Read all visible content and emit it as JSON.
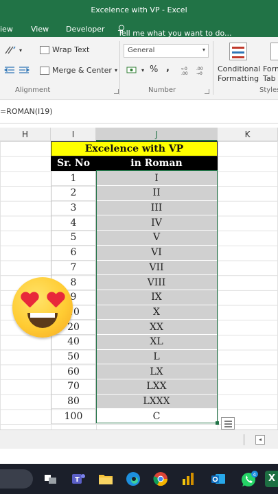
{
  "window": {
    "title": "Excelence with VP - Excel"
  },
  "ribbon_tabs": [
    "iew",
    "View",
    "Developer"
  ],
  "tell_me": "Tell me what you want to do...",
  "ribbon": {
    "wrap_text": "Wrap Text",
    "merge_center": "Merge & Center",
    "number_format": "General",
    "percent": "%",
    "comma": ",",
    "conditional_formatting_line1": "Conditional",
    "conditional_formatting_line2": "Formatting",
    "format_as_table_line1": "Form",
    "format_as_table_line2": "Tab",
    "groups": {
      "alignment": "Alignment",
      "number": "Number",
      "styles": "Styles"
    }
  },
  "formula_bar": {
    "formula": "=ROMAN(I19)"
  },
  "columns": [
    "H",
    "I",
    "J",
    "K"
  ],
  "table": {
    "title": "Excelence with VP",
    "headers": [
      "Sr. No",
      "in Roman"
    ],
    "rows": [
      [
        "1",
        "I"
      ],
      [
        "2",
        "II"
      ],
      [
        "3",
        "III"
      ],
      [
        "4",
        "IV"
      ],
      [
        "5",
        "V"
      ],
      [
        "6",
        "VI"
      ],
      [
        "7",
        "VII"
      ],
      [
        "8",
        "VIII"
      ],
      [
        "9",
        "IX"
      ],
      [
        "10",
        "X"
      ],
      [
        "20",
        "XX"
      ],
      [
        "40",
        "XL"
      ],
      [
        "50",
        "L"
      ],
      [
        "60",
        "LX"
      ],
      [
        "70",
        "LXX"
      ],
      [
        "80",
        "LXXX"
      ],
      [
        "100",
        "C"
      ]
    ]
  },
  "colors": {
    "excel_green": "#217346",
    "title_fill": "#ffff00",
    "header_fill": "#000000",
    "selection_fill": "#d0d0d0"
  },
  "icons": [
    "rotate-text-icon",
    "wrap-text-icon",
    "indent-icon",
    "merge-icon",
    "currency-icon",
    "percent-icon",
    "comma-icon",
    "decimal-increase-icon",
    "conditional-formatting-icon",
    "quick-analysis-icon",
    "love-eyes-emoji",
    "task-view-icon",
    "teams-icon",
    "file-explorer-icon",
    "edge-icon",
    "chrome-icon",
    "power-bi-icon",
    "outlook-icon",
    "whatsapp-icon",
    "excel-icon"
  ],
  "taskbar": {
    "whatsapp_badge": "4",
    "excel_label": "X"
  }
}
